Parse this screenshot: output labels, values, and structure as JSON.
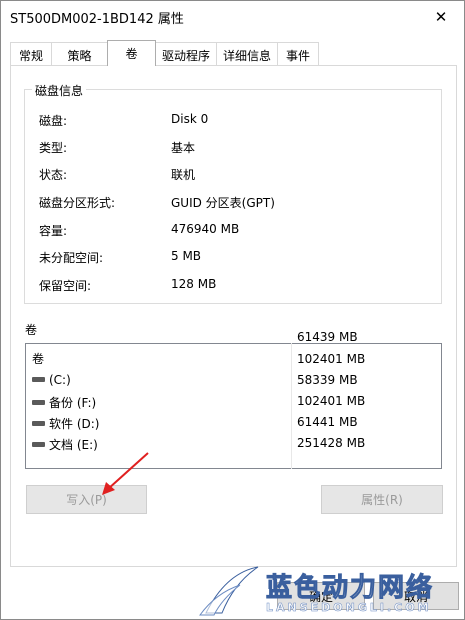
{
  "window": {
    "title": "ST500DM002-1BD142 属性",
    "close_glyph": "✕"
  },
  "tabs": [
    {
      "label": "常规"
    },
    {
      "label": "策略"
    },
    {
      "label": "卷",
      "active": true
    },
    {
      "label": "驱动程序"
    },
    {
      "label": "详细信息"
    },
    {
      "label": "事件"
    }
  ],
  "disk_info": {
    "group_title": "磁盘信息",
    "rows": [
      {
        "label": "磁盘:",
        "value": "Disk 0"
      },
      {
        "label": "类型:",
        "value": "基本"
      },
      {
        "label": "状态:",
        "value": "联机"
      },
      {
        "label": "磁盘分区形式:",
        "value": "GUID 分区表(GPT)"
      },
      {
        "label": "容量:",
        "value": "476940 MB"
      },
      {
        "label": "未分配空间:",
        "value": "5 MB"
      },
      {
        "label": "保留空间:",
        "value": "128 MB"
      }
    ]
  },
  "volumes": {
    "section_label": "卷",
    "top_overflow_value": "61439 MB",
    "header": {
      "name": "卷",
      "capacity": "102401 MB"
    },
    "items": [
      {
        "name": "(C:)",
        "capacity": "58339 MB"
      },
      {
        "name": "备份 (F:)",
        "capacity": "102401 MB"
      },
      {
        "name": "软件 (D:)",
        "capacity": "61441 MB"
      },
      {
        "name": "文档 (E:)",
        "capacity": "251428 MB"
      }
    ]
  },
  "buttons": {
    "populate": "写入(P)",
    "properties": "属性(R)",
    "ok": "确定",
    "cancel": "取消"
  },
  "watermark": {
    "text": "蓝色动力网络",
    "url": "LANSEDONGLI.COM"
  },
  "colors": {
    "arrow": "#e02020",
    "watermark_stroke": "#3a5f9e"
  }
}
